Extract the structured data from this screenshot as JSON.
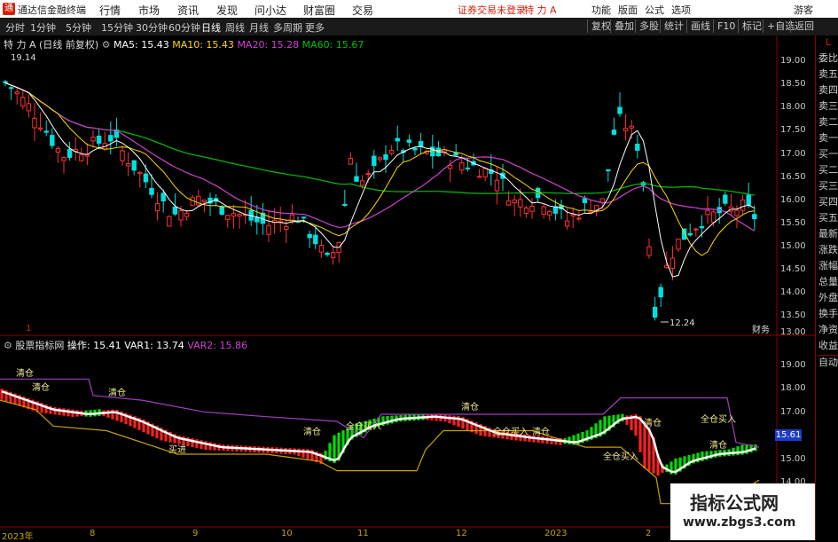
{
  "titlebar": {
    "app_name": "通达信金融终端",
    "menus": [
      "行情",
      "市场",
      "资讯",
      "发现",
      "问小达",
      "财富圈",
      "交易"
    ],
    "trade_status": "证券交易未登录",
    "stock_name": "特 力 A",
    "right_menus": [
      "功能",
      "版面",
      "公式",
      "选项"
    ],
    "guest": "游客"
  },
  "toolbar": {
    "periods": [
      "分时",
      "1分钟",
      "5分钟",
      "15分钟",
      "30分钟",
      "60分钟",
      "日线",
      "周线",
      "月线",
      "多周期",
      "更多"
    ],
    "active_period": "日线",
    "buttons": [
      "复权",
      "叠加",
      "多股",
      "统计",
      "画线",
      "F10",
      "标记",
      "+自选",
      "返回"
    ]
  },
  "main_chart": {
    "title": "特 力 A",
    "subtitle": "(日线 前复权)",
    "ma": [
      {
        "label": "MA5: 15.43",
        "color": "#ffffff"
      },
      {
        "label": "MA10: 15.43",
        "color": "#ffd700"
      },
      {
        "label": "MA20: 15.28",
        "color": "#d040d0"
      },
      {
        "label": "MA60: 15.67",
        "color": "#00c000"
      }
    ],
    "high_label": "19.14",
    "low_label": "12.24",
    "event_marks": [
      "1",
      "财务"
    ],
    "y_ticks": [
      "19.00",
      "18.50",
      "18.00",
      "17.50",
      "17.00",
      "16.50",
      "16.00",
      "15.50",
      "15.00",
      "14.50",
      "14.00",
      "13.50",
      "13.00"
    ]
  },
  "sub_chart": {
    "title": "股票指标网",
    "fields": [
      {
        "label": "操作: 15.41",
        "color": "#ffffff"
      },
      {
        "label": "VAR1: 13.74",
        "color": "#ffffff"
      },
      {
        "label": "VAR2: 15.86",
        "color": "#d040d0"
      }
    ],
    "y_ticks": [
      "19.00",
      "18.00",
      "17.00",
      "15.00",
      "14.00"
    ],
    "current_price": "15.61",
    "signals": [
      "清仓",
      "清仓",
      "清仓",
      "买进",
      "清仓",
      "全仓买入",
      "清仓",
      "全仓买入",
      "清仓",
      "全仓买入",
      "清仓",
      "全仓买入",
      "清仓"
    ]
  },
  "sidebar": {
    "items": [
      "L",
      "委比",
      "卖五",
      "卖四",
      "卖三",
      "卖二",
      "卖一",
      "买一",
      "买二",
      "买三",
      "买四",
      "买五",
      "最新",
      "涨跌",
      "涨幅",
      "总量",
      "外盘",
      "换手",
      "净资",
      "收益",
      "自动"
    ]
  },
  "dates": [
    "2023年",
    "8",
    "9",
    "10",
    "11",
    "12",
    "2023",
    "2"
  ],
  "watermark": {
    "line1": "指标公式网",
    "line2": "www.zbgs3.com"
  }
}
